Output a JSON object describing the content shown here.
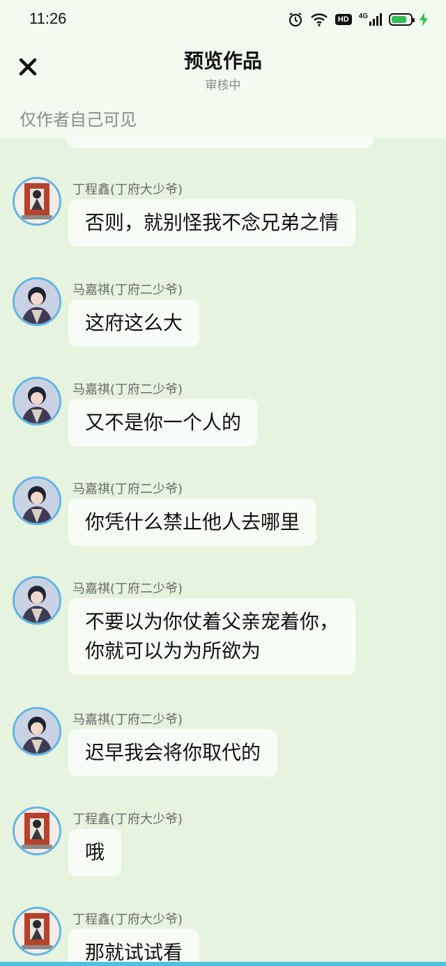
{
  "status_bar": {
    "time": "11:26",
    "hd": "HD",
    "network": "4G",
    "icons": [
      "alarm-icon",
      "wifi-icon",
      "hd-icon",
      "signal-icon",
      "battery-icon",
      "charging-icon"
    ]
  },
  "header": {
    "title": "预览作品",
    "subtitle": "审核中",
    "visibility_note": "仅作者自己可见"
  },
  "messages": [
    {
      "name": "丁程鑫(丁府大少爷)",
      "avatar": "avatar-ding",
      "text": "否则，就别怪我不念兄弟之情"
    },
    {
      "name": "马嘉祺(丁府二少爷)",
      "avatar": "avatar-ma",
      "text": "这府这么大"
    },
    {
      "name": "马嘉祺(丁府二少爷)",
      "avatar": "avatar-ma",
      "text": "又不是你一个人的"
    },
    {
      "name": "马嘉祺(丁府二少爷)",
      "avatar": "avatar-ma",
      "text": "你凭什么禁止他人去哪里"
    },
    {
      "name": "马嘉祺(丁府二少爷)",
      "avatar": "avatar-ma",
      "text": "不要以为你仗着父亲宠着你，\n你就可以为为所欲为"
    },
    {
      "name": "马嘉祺(丁府二少爷)",
      "avatar": "avatar-ma",
      "text": "迟早我会将你取代的"
    },
    {
      "name": "丁程鑫(丁府大少爷)",
      "avatar": "avatar-ding",
      "text": "哦"
    },
    {
      "name": "丁程鑫(丁府大少爷)",
      "avatar": "avatar-ding",
      "text": "那就试试看"
    }
  ],
  "colors": {
    "background": "#e6f3de",
    "header_background": "#f3fbf0",
    "bubble": "#f8fcf6",
    "avatar_ring": "#5fb4e6",
    "battery": "#2fbf55"
  }
}
